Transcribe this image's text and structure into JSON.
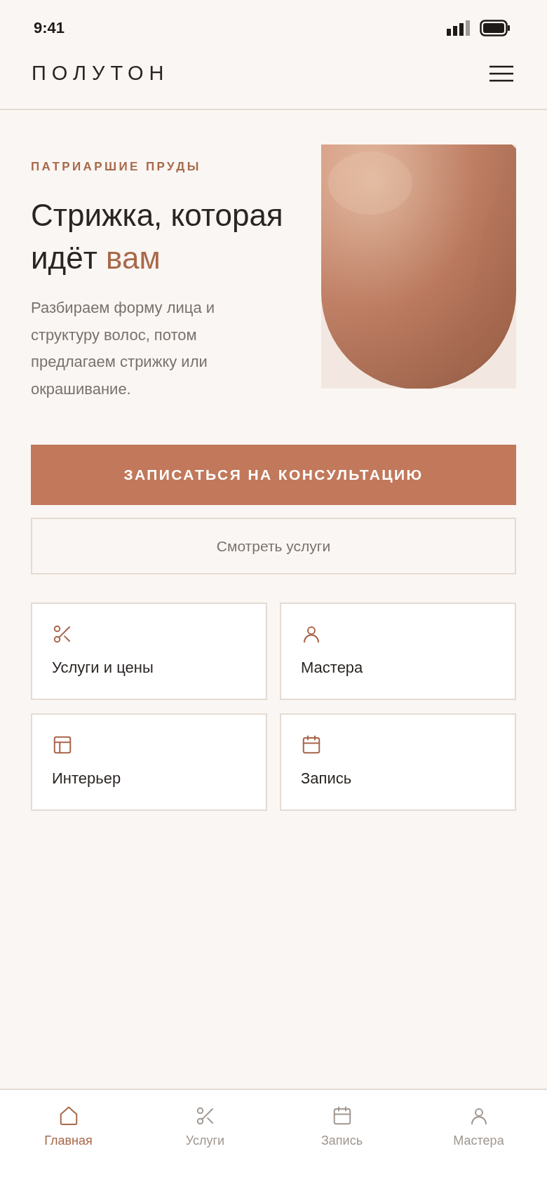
{
  "status_bar": {
    "time": "9:41"
  },
  "header": {
    "logo": "ПОЛУТОН"
  },
  "hero": {
    "eyebrow": "ПАТРИАРШИЕ ПРУДЫ",
    "title": "Стрижка, которая идёт",
    "title_accent": "вам",
    "text": "Разбираем форму лица и структуру волос, потом предлагаем стрижку или окрашивание."
  },
  "primary_button": "ЗАПИСАТЬСЯ НА КОНСУЛЬТАЦИЮ",
  "secondary_button": "Смотреть услуги",
  "tiles": [
    {
      "kind": "scissors",
      "label": "Услуги и цены"
    },
    {
      "kind": "person",
      "label": "Мастера"
    },
    {
      "kind": "layout",
      "label": "Интерьер"
    },
    {
      "kind": "calendar",
      "label": "Запись"
    }
  ],
  "tab_bar": [
    {
      "kind": "home",
      "label": "Главная",
      "selected": true
    },
    {
      "kind": "scissors",
      "label": "Услуги",
      "selected": false
    },
    {
      "kind": "calendar",
      "label": "Запись",
      "selected": false
    },
    {
      "kind": "person",
      "label": "Мастера",
      "selected": false
    }
  ]
}
